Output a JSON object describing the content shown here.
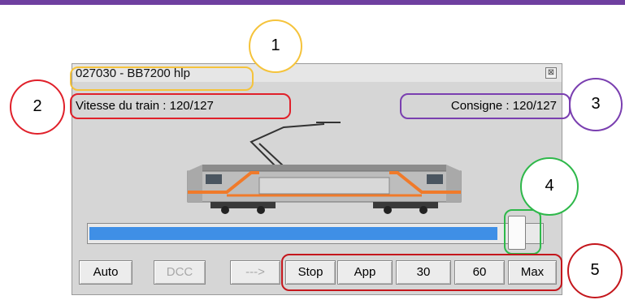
{
  "window": {
    "title": "027030 - BB7200 hlp",
    "close_glyph": "⊠",
    "speed_label": "Vitesse du train : 120/127",
    "consigne_label": "Consigne : 120/127",
    "throttle_value": 120,
    "throttle_max": 127
  },
  "buttons": [
    {
      "label": "Auto",
      "enabled": true
    },
    {
      "label": "DCC",
      "enabled": false
    },
    {
      "label": "--->",
      "enabled": false
    },
    {
      "label": "Stop",
      "enabled": true
    },
    {
      "label": "App",
      "enabled": true
    },
    {
      "label": "30",
      "enabled": true
    },
    {
      "label": "60",
      "enabled": true
    },
    {
      "label": "Max",
      "enabled": true
    }
  ],
  "annotations": [
    {
      "number": "1",
      "color": "#f5c33b"
    },
    {
      "number": "2",
      "color": "#e0202a"
    },
    {
      "number": "3",
      "color": "#7a3fb0"
    },
    {
      "number": "4",
      "color": "#2eb84a"
    },
    {
      "number": "5",
      "color": "#c4161c"
    }
  ],
  "colors": {
    "accent_bar": "#6f3fa0",
    "throttle_fill": "#3f8fe6"
  }
}
